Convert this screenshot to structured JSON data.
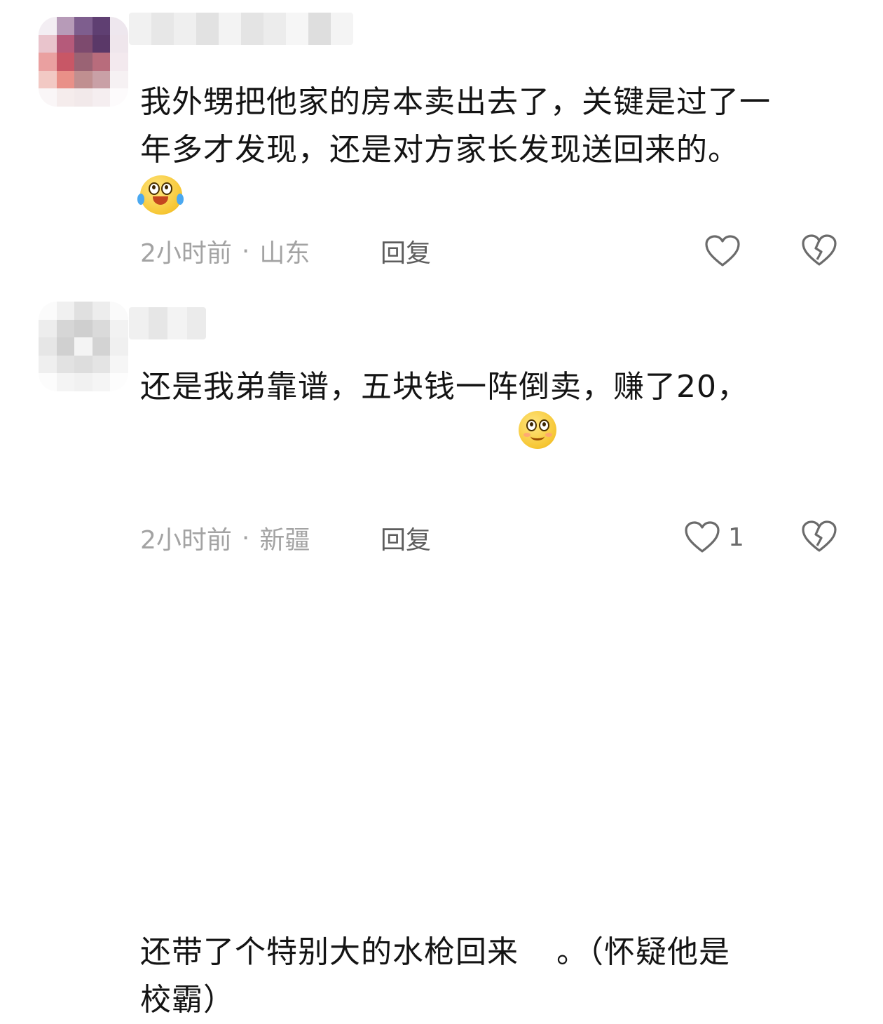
{
  "comments": [
    {
      "text": "我外甥把他家的房本卖出去了，关键是过了一\n年多才发现，还是对方家长发现送回来的。",
      "emoji_icon": "crying-laugh-emoji-icon",
      "time": "2小时前",
      "separator": "·",
      "location": "山东",
      "reply_label": "回复",
      "like_count": ""
    },
    {
      "text_before_emoji": "还是我弟靠谱，五块钱一阵倒卖，赚了20，\n还带了个特别大的水枪回来",
      "emoji_icon": "smiling-emoji-icon",
      "text_after_emoji": "。（怀疑他是\n校霸）",
      "time": "2小时前",
      "separator": "·",
      "location": "新疆",
      "reply_label": "回复",
      "like_count": "1"
    }
  ],
  "colors": {
    "text": "#141414",
    "meta": "#a3a3a3",
    "reply": "#5d5d5d",
    "icon": "#6b6b6b",
    "emoji_yellow": "#f6c633"
  },
  "icons": {
    "like": "heart-outline-icon",
    "dislike": "broken-heart-icon"
  }
}
